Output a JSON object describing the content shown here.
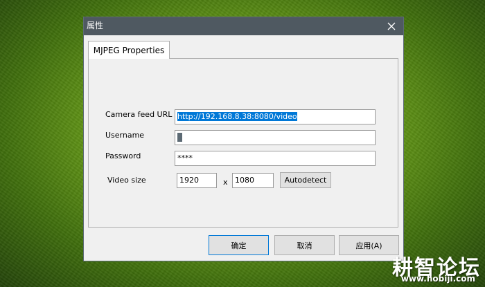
{
  "window": {
    "title": "属性",
    "close_glyph": "✕"
  },
  "tab": {
    "label": "MJPEG Properties"
  },
  "form": {
    "camera_feed_url_label": "Camera feed URL",
    "camera_feed_url_value": "http://192.168.8.38:8080/video",
    "username_label": "Username",
    "username_value": "",
    "password_label": "Password",
    "password_value": "****",
    "video_size_label": "Video size",
    "width_value": "1920",
    "separator": "x",
    "height_value": "1080",
    "autodetect_label": "Autodetect"
  },
  "buttons": {
    "ok": "确定",
    "cancel": "取消",
    "apply": "应用(A)"
  },
  "watermark": {
    "text": "耕智论坛",
    "url": "www.hobiji.com"
  },
  "colors": {
    "titlebar": "#4f5961",
    "selection": "#0078d7",
    "dialog_bg": "#f0f0f0"
  }
}
